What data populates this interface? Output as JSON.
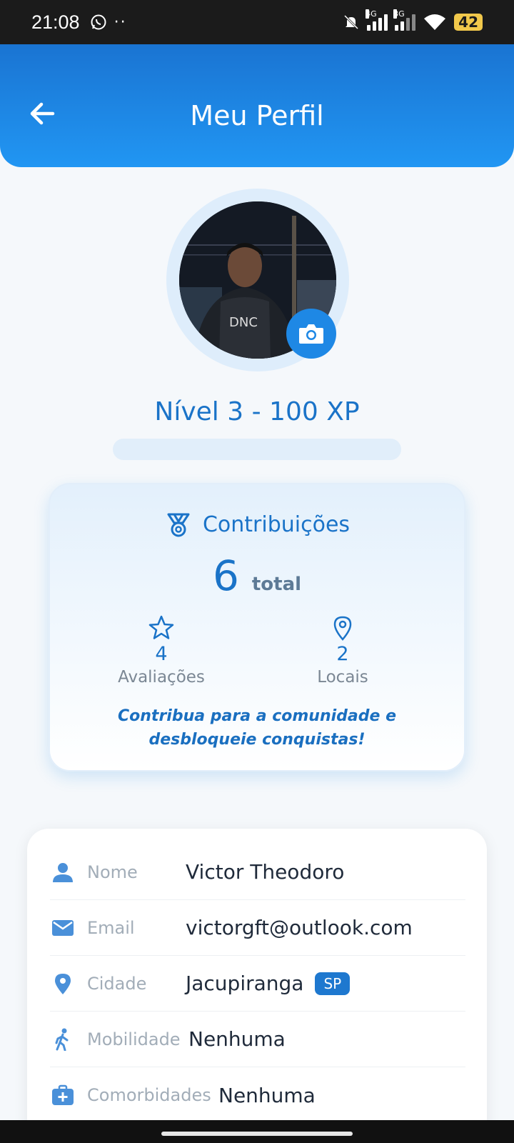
{
  "status_bar": {
    "time": "21:08",
    "signal1": "4G",
    "signal2": "3G",
    "battery": "42"
  },
  "header": {
    "title": "Meu Perfil",
    "back_icon": "arrow-left-icon",
    "color_start": "#1a74d2",
    "color_end": "#2196f3"
  },
  "profile": {
    "level_text": "Nível 3 - 100 XP",
    "xp_progress": 0,
    "camera_icon": "camera-icon"
  },
  "contributions": {
    "title": "Contribuições",
    "total": "6",
    "total_label": "total",
    "stats": [
      {
        "icon": "star-icon",
        "value": "4",
        "label": "Avaliações"
      },
      {
        "icon": "map-pin-icon",
        "value": "2",
        "label": "Locais"
      }
    ],
    "message": "Contribua para a comunidade e desbloqueie conquistas!"
  },
  "info": {
    "rows": [
      {
        "icon": "person-icon",
        "label": "Nome",
        "value": "Victor Theodoro"
      },
      {
        "icon": "email-icon",
        "label": "Email",
        "value": "victorgft@outlook.com"
      },
      {
        "icon": "location-icon",
        "label": "Cidade",
        "value": "Jacupiranga",
        "badge": "SP"
      },
      {
        "icon": "walking-icon",
        "label": "Mobilidade",
        "value": "Nenhuma"
      },
      {
        "icon": "medical-kit-icon",
        "label": "Comorbidades",
        "value": "Nenhuma"
      }
    ]
  },
  "colors": {
    "accent": "#1e88e5",
    "accent_dark": "#1a73c8"
  }
}
